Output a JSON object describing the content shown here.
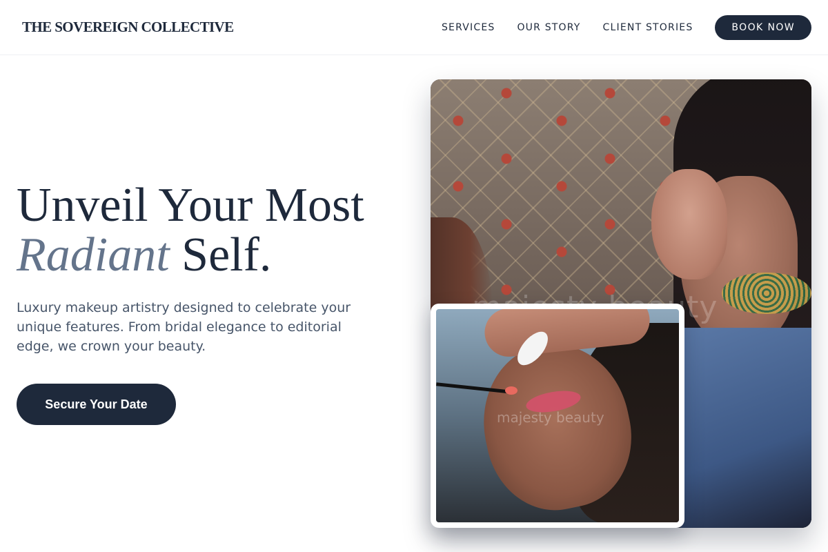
{
  "header": {
    "brand": "THE SOVEREIGN COLLECTIVE",
    "nav": [
      {
        "label": "SERVICES"
      },
      {
        "label": "OUR STORY"
      },
      {
        "label": "CLIENT STORIES"
      }
    ],
    "book_label": "BOOK NOW"
  },
  "hero": {
    "title_line1": "Unveil Your Most",
    "title_accent": "Radiant",
    "title_end": "Self.",
    "subtitle": "Luxury makeup artistry designed to celebrate your unique features. From bridal elegance to editorial edge, we crown your beauty.",
    "cta_label": "Secure Your Date"
  },
  "photos": {
    "main_watermark": "majesty beauty",
    "inset_watermark": "majesty beauty"
  },
  "colors": {
    "primary": "#1e293b",
    "accent_text": "#64748b",
    "body_text": "#475569"
  }
}
